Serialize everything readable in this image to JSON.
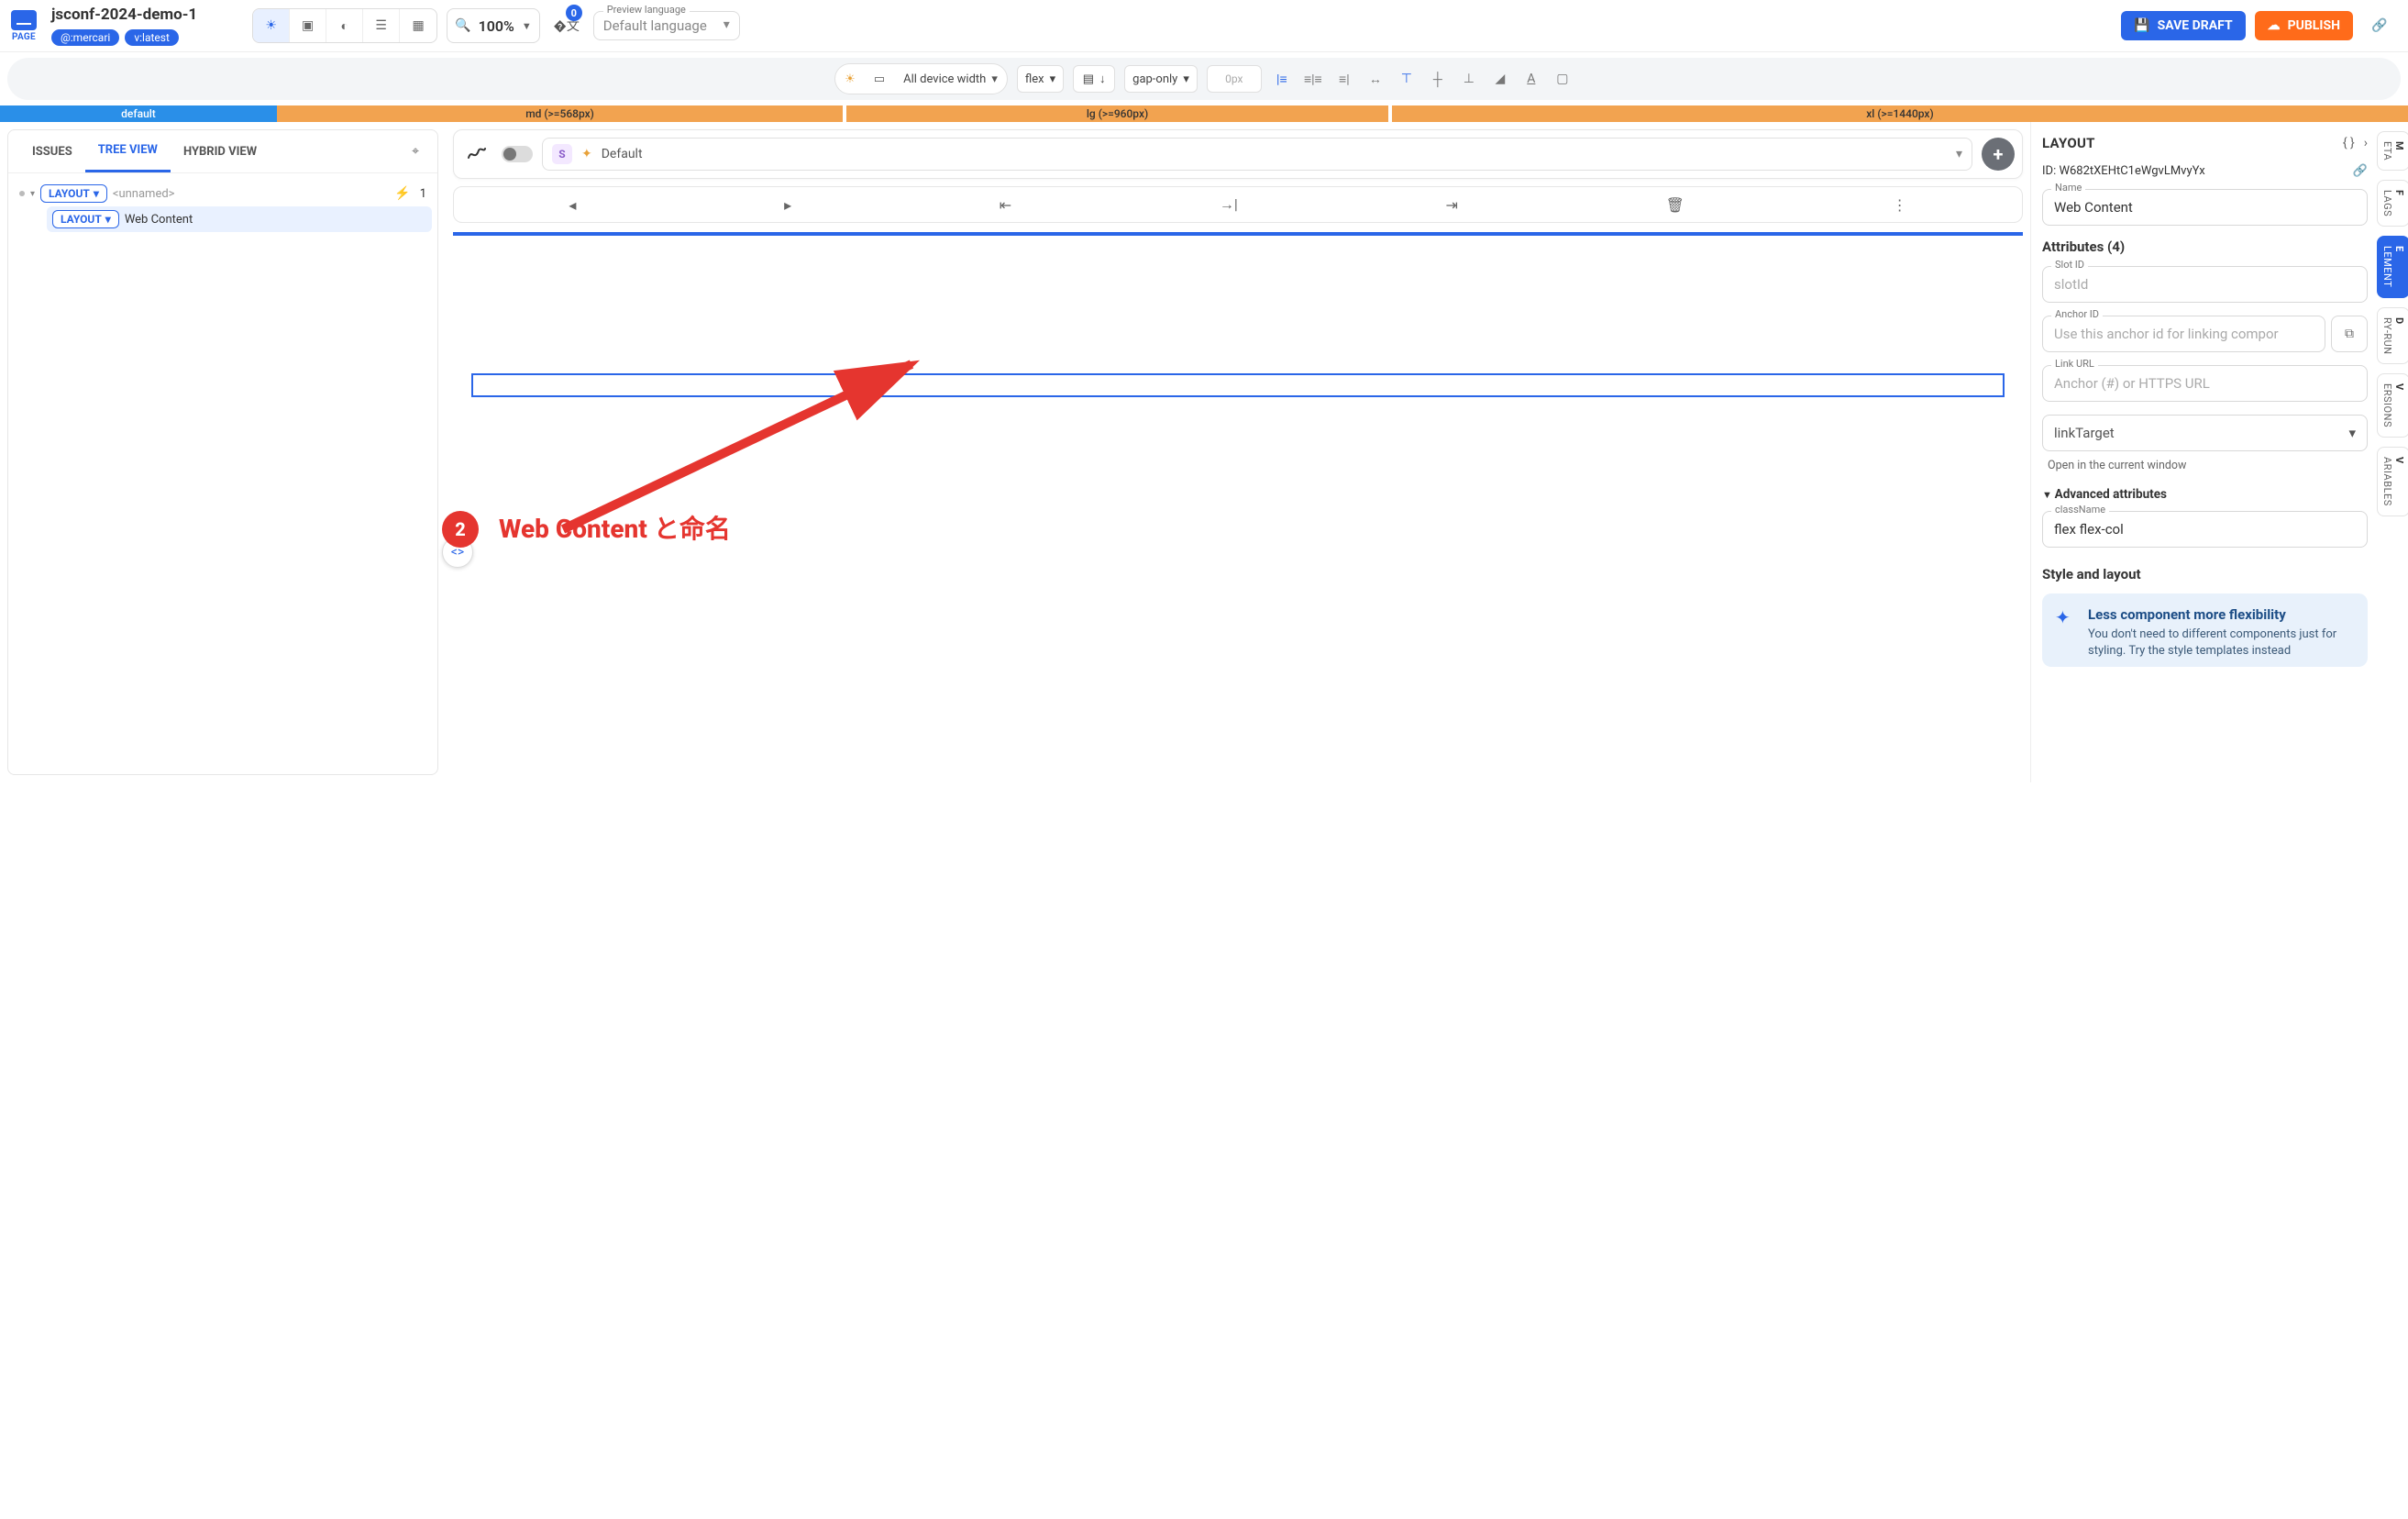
{
  "header": {
    "page_label": "PAGE",
    "title": "jsconf-2024-demo-1",
    "chips": [
      "@:mercari",
      "v:latest"
    ],
    "zoom": "100%",
    "translate_badge": "0",
    "lang_label": "Preview language",
    "lang_value": "Default language",
    "save_label": "SAVE DRAFT",
    "publish_label": "PUBLISH"
  },
  "toolbar2": {
    "device": "All device width",
    "display": "flex",
    "gap_mode": "gap-only",
    "gap_value": "0px"
  },
  "breakpoints": {
    "default": "default",
    "md": "md (>=568px)",
    "lg": "lg (>=960px)",
    "xl": "xl (>=1440px)"
  },
  "left": {
    "tabs": {
      "issues": "ISSUES",
      "tree": "TREE VIEW",
      "hybrid": "HYBRID VIEW"
    },
    "root_chip": "LAYOUT",
    "root_name": "<unnamed>",
    "root_count": "1",
    "child_chip": "LAYOUT",
    "child_name": "Web Content"
  },
  "mid": {
    "style_badge": "S",
    "style_name": "Default"
  },
  "annotation": {
    "num": "2",
    "text": "Web Content と命名"
  },
  "right": {
    "title": "LAYOUT",
    "id_label": "ID:",
    "id_value": "W682tXEHtC1eWgvLMvyYx",
    "name_label": "Name",
    "name_value": "Web Content",
    "attrs_heading": "Attributes (4)",
    "slot_label": "Slot ID",
    "slot_placeholder": "slotId",
    "anchor_label": "Anchor ID",
    "anchor_placeholder": "Use this anchor id for linking compor",
    "link_label": "Link URL",
    "link_placeholder": "Anchor (#) or HTTPS URL",
    "linktarget_value": "linkTarget",
    "linktarget_hint": "Open in the current window",
    "adv_heading": "Advanced attributes",
    "classname_label": "className",
    "classname_value": "flex flex-col",
    "style_heading": "Style and layout",
    "info_title": "Less component more flexibility",
    "info_body": "You don't need to different components just for styling. Try the style templates instead"
  },
  "rail": {
    "meta": {
      "lead": "M",
      "rest": "ETA"
    },
    "flags": {
      "lead": "F",
      "rest": "LAGS"
    },
    "element": {
      "lead": "E",
      "rest": "LEMENT"
    },
    "dryrun": {
      "lead": "D",
      "rest": "RY-RUN"
    },
    "versions": {
      "lead": "V",
      "rest": "ERSIONS"
    },
    "variables": {
      "lead": "V",
      "rest": "ARIABLES"
    }
  }
}
